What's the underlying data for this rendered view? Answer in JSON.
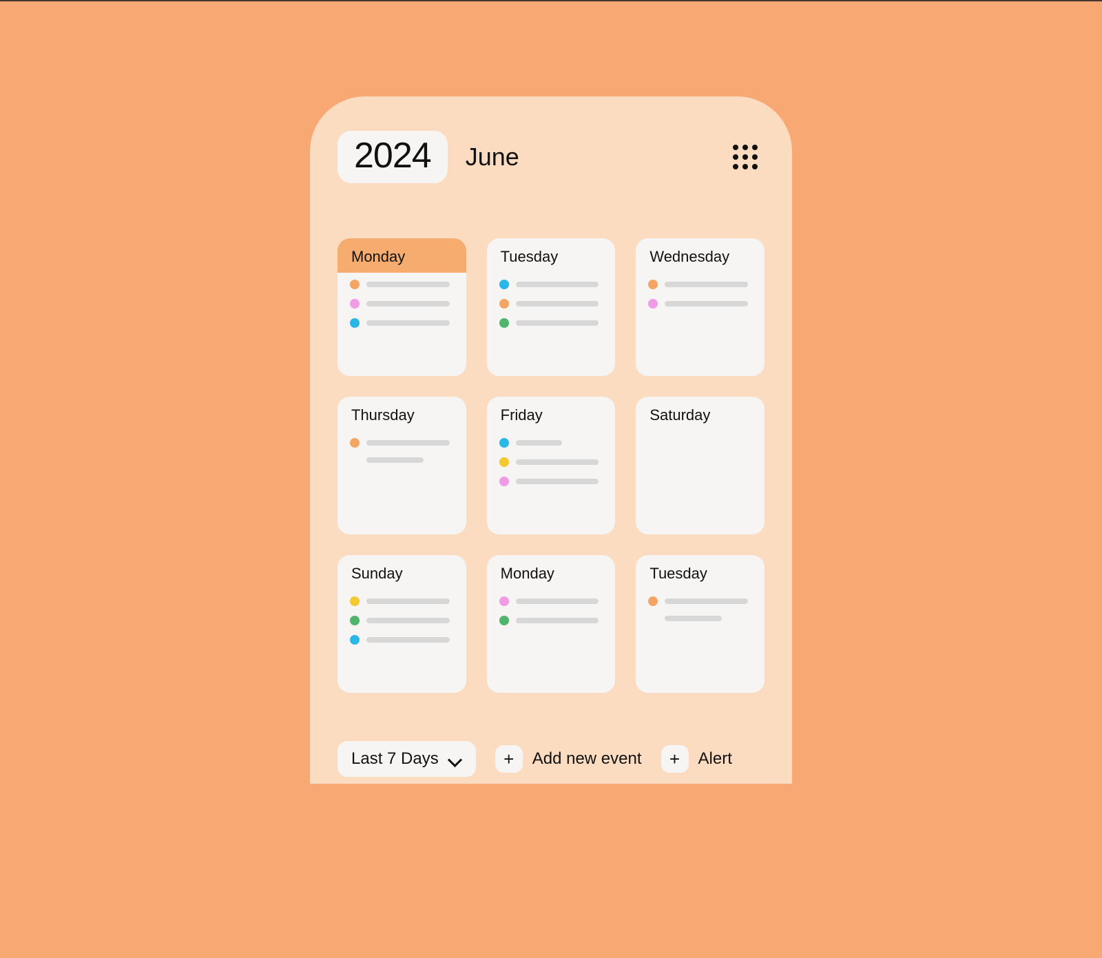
{
  "header": {
    "year": "2024",
    "month": "June"
  },
  "colors": {
    "orange": "#f4a564",
    "pink": "#f19ae6",
    "blue": "#2bb6e8",
    "green": "#4fb56c",
    "yellow": "#f2c92e"
  },
  "days": [
    {
      "label": "Monday",
      "active": true,
      "events": [
        {
          "c": "orange",
          "len": "long"
        },
        {
          "c": "pink",
          "len": "long"
        },
        {
          "c": "blue",
          "len": "long"
        }
      ]
    },
    {
      "label": "Tuesday",
      "active": false,
      "events": [
        {
          "c": "blue",
          "len": "long"
        },
        {
          "c": "orange",
          "len": "long"
        },
        {
          "c": "green",
          "len": "long"
        }
      ]
    },
    {
      "label": "Wednesday",
      "active": false,
      "events": [
        {
          "c": "orange",
          "len": "long"
        },
        {
          "c": "pink",
          "len": "long"
        }
      ]
    },
    {
      "label": "Thursday",
      "active": false,
      "events": [
        {
          "c": "orange",
          "len": "long",
          "secondary": true
        }
      ]
    },
    {
      "label": "Friday",
      "active": false,
      "events": [
        {
          "c": "blue",
          "len": "short"
        },
        {
          "c": "yellow",
          "len": "long"
        },
        {
          "c": "pink",
          "len": "long"
        }
      ]
    },
    {
      "label": "Saturday",
      "active": false,
      "events": []
    },
    {
      "label": "Sunday",
      "active": false,
      "events": [
        {
          "c": "yellow",
          "len": "long"
        },
        {
          "c": "green",
          "len": "long"
        },
        {
          "c": "blue",
          "len": "long"
        }
      ]
    },
    {
      "label": "Monday",
      "active": false,
      "events": [
        {
          "c": "pink",
          "len": "long"
        },
        {
          "c": "green",
          "len": "long"
        }
      ]
    },
    {
      "label": "Tuesday",
      "active": false,
      "events": [
        {
          "c": "orange",
          "len": "long",
          "secondary": true
        }
      ]
    }
  ],
  "controls": {
    "range_label": "Last 7 Days",
    "add_event_label": "Add new event",
    "alert_label": "Alert"
  }
}
